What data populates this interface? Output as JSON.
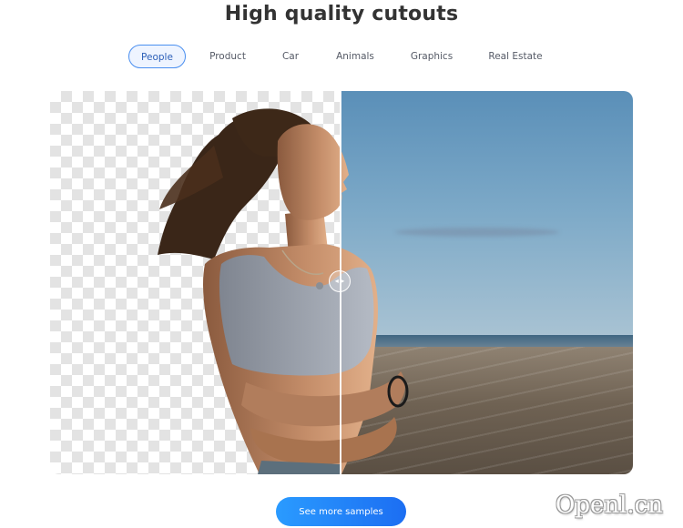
{
  "section": {
    "title": "High quality cutouts"
  },
  "tabs": [
    {
      "label": "People",
      "active": true
    },
    {
      "label": "Product",
      "active": false
    },
    {
      "label": "Car",
      "active": false
    },
    {
      "label": "Animals",
      "active": false
    },
    {
      "label": "Graphics",
      "active": false
    },
    {
      "label": "Real Estate",
      "active": false
    }
  ],
  "comparison": {
    "left_background": "transparent-checkerboard",
    "right_background": "beach-sky-photo",
    "handle_icon": "left-right-arrows-icon",
    "handle_glyph": "◂ ▸"
  },
  "cta": {
    "label": "See more samples"
  },
  "watermark": {
    "text": "Openl.cn"
  },
  "colors": {
    "accent": "#2c7df0",
    "active_tab_border": "#4a8ff0",
    "active_tab_bg": "#eef4ff",
    "title": "#333333"
  }
}
